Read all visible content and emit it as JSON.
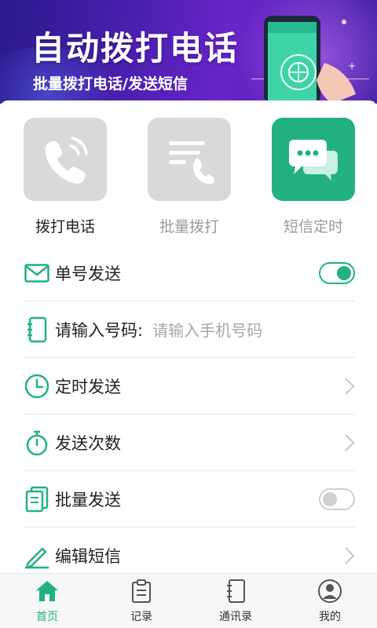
{
  "banner": {
    "title": "自动拨打电话",
    "subtitle": "批量拨打电话/发送短信"
  },
  "tiles": [
    {
      "label": "拨打电话",
      "icon": "phone-icon",
      "state": "gray-dark-label"
    },
    {
      "label": "批量拨打",
      "icon": "batch-dial-icon",
      "state": "gray"
    },
    {
      "label": "短信定时",
      "icon": "chat-bubble-icon",
      "state": "active"
    }
  ],
  "rows": {
    "single": {
      "label": "单号发送",
      "icon": "mail-icon",
      "toggle": true
    },
    "number": {
      "label": "请输入号码:",
      "placeholder": "请输入手机号码",
      "icon": "contact-book-icon"
    },
    "schedule": {
      "label": "定时发送",
      "icon": "clock-icon"
    },
    "count": {
      "label": "发送次数",
      "icon": "stopwatch-icon"
    },
    "batch": {
      "label": "批量发送",
      "icon": "documents-icon",
      "toggle": false
    },
    "edit": {
      "label": "编辑短信",
      "icon": "pen-icon"
    }
  },
  "tabs": [
    {
      "label": "首页",
      "icon": "home-icon",
      "active": true
    },
    {
      "label": "记录",
      "icon": "clipboard-icon",
      "active": false
    },
    {
      "label": "通讯录",
      "icon": "address-book-icon",
      "active": false
    },
    {
      "label": "我的",
      "icon": "user-icon",
      "active": false
    }
  ],
  "colors": {
    "accent": "#21b27f",
    "banner_start": "#2a1a8c",
    "banner_end": "#6a24c8",
    "tile_gray": "#d9d9d9"
  }
}
